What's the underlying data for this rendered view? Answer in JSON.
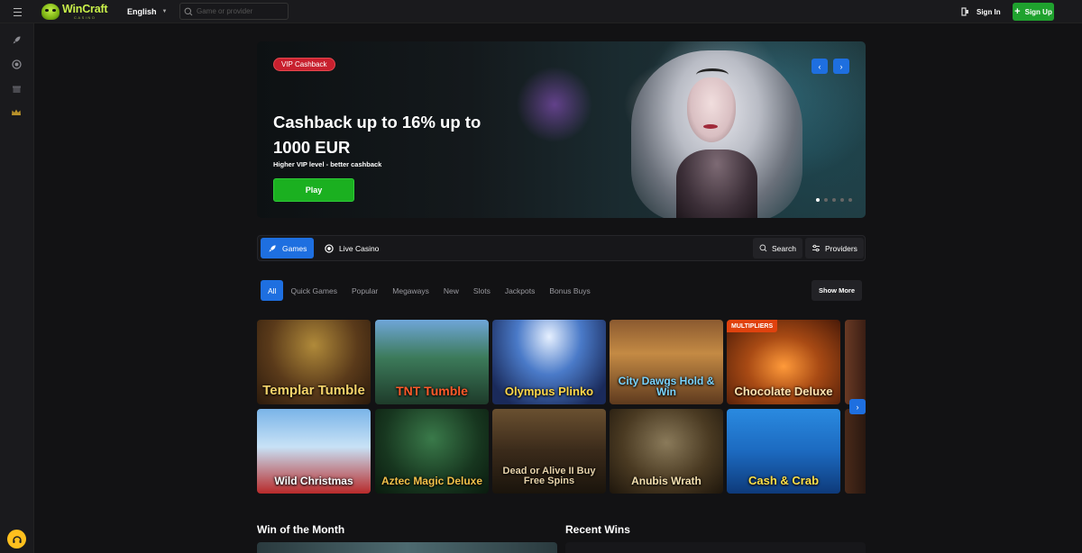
{
  "brand": {
    "name": "WinCraft",
    "sub": "CASINO"
  },
  "header": {
    "language": "English",
    "search_placeholder": "Game or provider",
    "sign_in": "Sign In",
    "sign_up": "Sign Up"
  },
  "sidebar": {
    "icons": [
      "rocket-icon",
      "live-chip-icon",
      "gift-icon",
      "crown-icon"
    ]
  },
  "hero": {
    "badge": "VIP Cashback",
    "title": "Cashback up to 16% up to 1000 EUR",
    "subtitle": "Higher VIP level - better cashback",
    "cta": "Play",
    "slide_count": 5,
    "active_slide": 1
  },
  "tabs": {
    "games": "Games",
    "live_casino": "Live Casino",
    "search": "Search",
    "providers": "Providers"
  },
  "categories": [
    "All",
    "Quick Games",
    "Popular",
    "Megaways",
    "New",
    "Slots",
    "Jackpots",
    "Bonus Buys"
  ],
  "show_more": "Show More",
  "games": [
    {
      "title": "Templar Tumble",
      "badge": ""
    },
    {
      "title": "TNT Tumble",
      "badge": ""
    },
    {
      "title": "Olympus Plinko",
      "badge": ""
    },
    {
      "title": "City Dawgs Hold & Win",
      "badge": ""
    },
    {
      "title": "Chocolate Deluxe",
      "badge": "MULTIPLIERS"
    },
    {
      "title": "Wild Christmas",
      "badge": ""
    },
    {
      "title": "Aztec Magic Deluxe",
      "badge": ""
    },
    {
      "title": "Dead or Alive II Buy Free Spins",
      "badge": ""
    },
    {
      "title": "Anubis Wrath",
      "badge": ""
    },
    {
      "title": "Cash & Crab",
      "badge": ""
    }
  ],
  "sections": {
    "win_of_month": "Win of the Month",
    "recent_wins": "Recent Wins"
  }
}
